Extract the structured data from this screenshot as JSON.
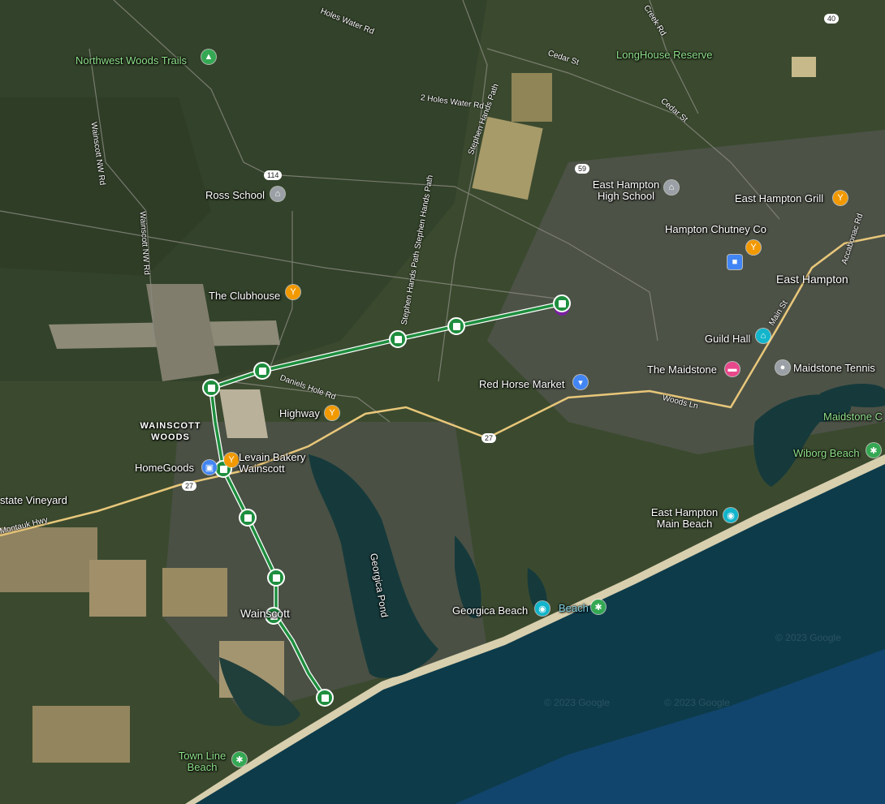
{
  "places": {
    "northwest_woods_trails": "Northwest Woods Trails",
    "longhouse_reserve": "LongHouse Reserve",
    "ross_school": "Ross School",
    "east_hampton_high_school": "East Hampton High School",
    "east_hampton_grill": "East Hampton Grill",
    "hampton_chutney": "Hampton Chutney Co",
    "east_hampton": "East Hampton",
    "the_clubhouse": "The Clubhouse",
    "guild_hall": "Guild Hall",
    "the_maidstone": "The Maidstone",
    "maidstone_tennis": "Maidstone Tennis",
    "maidstone_c": "Maidstone C",
    "red_horse_market": "Red Horse Market",
    "highway": "Highway",
    "wainscott_woods": "WAINSCOTT WOODS",
    "levain_bakery": "Levain Bakery Wainscott",
    "homegoods": "HomeGoods",
    "state_vineyard": "state Vineyard",
    "wiborg_beach": "Wiborg Beach",
    "east_hampton_main_beach": "East Hampton Main Beach",
    "georgica_pond": "Georgica Pond",
    "georgica_beach": "Georgica Beach",
    "beach": "Beach",
    "wainscott": "Wainscott",
    "town_line_beach": "Town Line Beach"
  },
  "roads": {
    "holes_water_rd_top": "Holes Water Rd",
    "creek_rd": "Creek Rd",
    "cedar_st_top": "Cedar St",
    "cedar_st": "Cedar St",
    "two_holes_water_rd": "2 Holes Water Rd",
    "stephen_hands_path": "Stephen Hands Path",
    "stephen_hands_path_2": "Stephen Hands Path Stephen Hands Path",
    "wainscott_nw_rd": "Wainscott NW Rd",
    "wainscott_nw_rd_2": "Wainscott NW Rd",
    "daniels_hole_rd": "Daniels Hole Rd",
    "woods_ln": "Woods Ln",
    "main_st": "Main St",
    "accabonac_rd": "Accabonac Rd",
    "montauk_hwy": "Montauk Hwy"
  },
  "shields": {
    "r40": "40",
    "r114": "114",
    "r59": "59",
    "r27a": "27",
    "r27b": "27"
  },
  "watermarks": {
    "w1": "© 2023 Google",
    "w2": "© 2023 Google",
    "w3": "© 2023 Google"
  },
  "colors": {
    "route": "#1e8e3e",
    "route_edge": "#ffffff",
    "main_road": "#e8c77a",
    "water": "#0d3b4a",
    "food_pin": "#f29900",
    "school_pin": "#9aa0a6",
    "shopping_pin": "#4285f4",
    "hotel_pin": "#e8478b",
    "attraction_pin": "#12b5cb",
    "park_pin": "#34a853"
  },
  "route": {
    "stop_count": 10
  }
}
